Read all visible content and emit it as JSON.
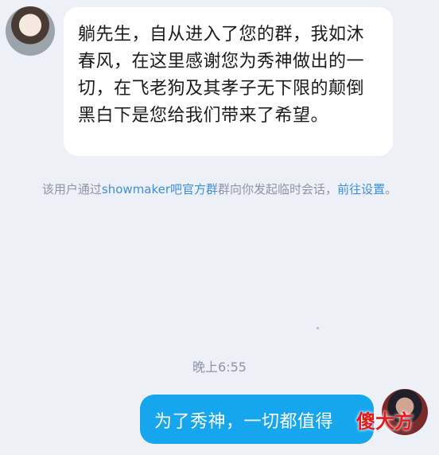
{
  "incoming": {
    "text": "躺先生，自从进入了您的群，我如沐春风，在这里感谢您为秀神做出的一切，在飞老狗及其孝子无下限的颠倒黑白下是您给我们带来了希望。"
  },
  "notice": {
    "prefix": "该用户通过",
    "group_link": "showmaker吧官方群",
    "middle": "群向你发起临时会话，",
    "settings_link": "前往设置",
    "suffix": "。"
  },
  "time": "晚上6:55",
  "outgoing": {
    "text": "为了秀神，一切都值得"
  },
  "watermark": "傻大方"
}
